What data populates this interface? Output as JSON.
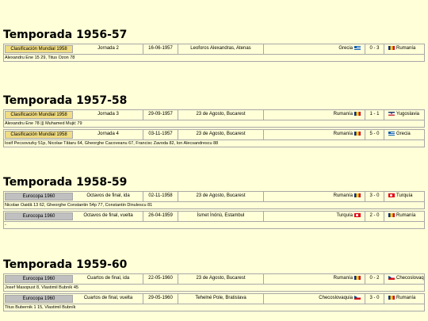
{
  "seasons": [
    {
      "title": "Temporada 1956-57",
      "matches": [
        {
          "competition": "Clasificación Mundial 1958",
          "comp_type": "wc",
          "round": "Jornada 2",
          "date": "16-06-1957",
          "venue": "Leoforos Alexandras, Atenas",
          "home": "Grecia",
          "home_flag": "flag-gr",
          "score": "0 - 3",
          "away": "Rumanía",
          "away_flag": "flag-ro",
          "scorers": "Alexandru Ene 15 29, Titus Ozon 78"
        }
      ]
    },
    {
      "title": "Temporada 1957-58",
      "matches": [
        {
          "competition": "Clasificación Mundial 1958",
          "comp_type": "wc",
          "round": "Jornada 3",
          "date": "29-09-1957",
          "venue": "23 de Agosto, Bucarest",
          "home": "Rumanía",
          "home_flag": "flag-ro",
          "score": "1 - 1",
          "away": "Yugoslavia",
          "away_flag": "flag-yu",
          "scorers": "Alexandru Ene 78 ||| Muhamed Mujić 79"
        },
        {
          "competition": "Clasificación Mundial 1958",
          "comp_type": "wc",
          "round": "Jornada 4",
          "date": "03-11-1957",
          "venue": "23 de Agosto, Bucarest",
          "home": "Rumanía",
          "home_flag": "flag-ro",
          "score": "5 - 0",
          "away": "Grecia",
          "away_flag": "flag-gr",
          "scorers": "Iosif Pecsovszky 51p, Nicolae Tătaru 64, Gheorghe Cacoveanu 67, Francisc Zavoda 82, Ion Alecsandrescu 88"
        }
      ]
    },
    {
      "title": "Temporada 1958-59",
      "matches": [
        {
          "competition": "Eurocopa 1960",
          "comp_type": "euro",
          "round": "Octavos de final, ida",
          "date": "02-11-1958",
          "venue": "23 de Agosto, Bucarest",
          "home": "Rumanía",
          "home_flag": "flag-ro",
          "score": "3 - 0",
          "away": "Turquía",
          "away_flag": "flag-tr",
          "scorers": "Nicolae Oaidă 13 62, Gheorghe Constantin 54p 77, Constantin Dinulescu 81"
        },
        {
          "competition": "Eurocopa 1960",
          "comp_type": "euro",
          "round": "Octavos de final, vuelta",
          "date": "26-04-1959",
          "venue": "İsmet İnönü, Estambul",
          "home": "Turquía",
          "home_flag": "flag-tr",
          "score": "2 - 0",
          "away": "Rumanía",
          "away_flag": "flag-ro",
          "scorers": "-"
        }
      ]
    },
    {
      "title": "Temporada 1959-60",
      "matches": [
        {
          "competition": "Eurocopa 1960",
          "comp_type": "euro",
          "round": "Cuartos de final, ida",
          "date": "22-05-1960",
          "venue": "23 de Agosto, Bucarest",
          "home": "Rumanía",
          "home_flag": "flag-ro",
          "score": "0 - 2",
          "away": "Checoslovaquia",
          "away_flag": "flag-cz",
          "scorers": "Josef Masopust 8, Vlastimil Bubník 45"
        },
        {
          "competition": "Eurocopa 1960",
          "comp_type": "euro",
          "round": "Cuartos de final, vuelta",
          "date": "29-05-1960",
          "venue": "Tehelné Pole, Bratislava",
          "home": "Checoslovaquia",
          "home_flag": "flag-cz",
          "score": "3 - 0",
          "away": "Rumanía",
          "away_flag": "flag-ro",
          "scorers": "Titus Bubernik 1 15, Vlastimil Bubník"
        }
      ]
    }
  ]
}
